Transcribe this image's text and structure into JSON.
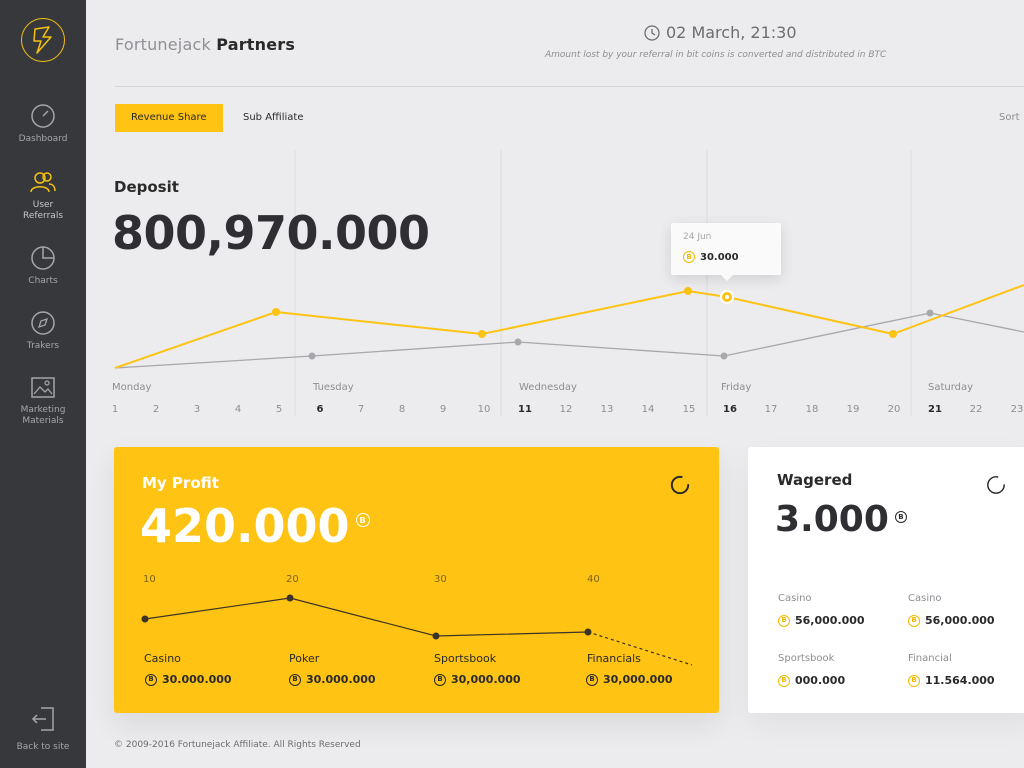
{
  "sidebar": {
    "items": [
      {
        "label": "Dashboard",
        "icon": "gauge-icon"
      },
      {
        "label": "User Referrals",
        "icon": "users-icon"
      },
      {
        "label": "Charts",
        "icon": "pie-chart-icon"
      },
      {
        "label": "Trakers",
        "icon": "compass-icon"
      },
      {
        "label": "Marketing Materials",
        "icon": "image-icon"
      }
    ],
    "back_label": "Back to site"
  },
  "header": {
    "brand_light": "Fortunejack",
    "brand_bold": "Partners",
    "datetime": "02 March, 21:30",
    "note": "Amount lost by your referral in bit coins is converted and distributed in BTC"
  },
  "tabs": {
    "active": "Revenue Share",
    "second": "Sub Affiliate",
    "sort": "Sort"
  },
  "deposit": {
    "label": "Deposit",
    "value": "800,970.000",
    "tooltip_date": "24 Jun",
    "tooltip_value": "30.000"
  },
  "timeline": {
    "days": [
      "Monday",
      "Tuesday",
      "Wednesday",
      "Friday",
      "Saturday"
    ],
    "dates": [
      "1",
      "2",
      "3",
      "4",
      "5",
      "6",
      "7",
      "8",
      "9",
      "10",
      "11",
      "12",
      "13",
      "14",
      "15",
      "16",
      "17",
      "18",
      "19",
      "20",
      "21",
      "22",
      "23"
    ]
  },
  "profit": {
    "title": "My Profit",
    "value": "420.000",
    "ticks": [
      "10",
      "20",
      "30",
      "40"
    ],
    "categories": [
      {
        "name": "Casino",
        "amount": "30.000.000"
      },
      {
        "name": "Poker",
        "amount": "30.000.000"
      },
      {
        "name": "Sportsbook",
        "amount": "30,000.000"
      },
      {
        "name": "Financials",
        "amount": "30,000.000"
      }
    ]
  },
  "wagered": {
    "title": "Wagered",
    "value": "3.000",
    "items": [
      {
        "name": "Casino",
        "amount": "56,000.000"
      },
      {
        "name": "Casino",
        "amount": "56,000.000"
      },
      {
        "name": "Sportsbook",
        "amount": "000.000"
      },
      {
        "name": "Financial",
        "amount": "11.564.000"
      }
    ]
  },
  "footer": {
    "copyright": "© 2009-2016 Fortunejack Affiliate. All Rights Reserved"
  },
  "colors": {
    "accent": "#fec313",
    "sidebar": "#36383b",
    "background": "#ececee"
  }
}
